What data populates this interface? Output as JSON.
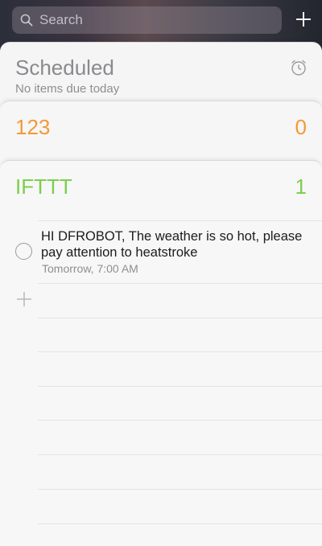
{
  "search": {
    "placeholder": "Search"
  },
  "header": {
    "add_icon": "plus-icon"
  },
  "scheduled": {
    "title": "Scheduled",
    "subtitle": "No items due today",
    "icon": "alarm-clock-icon"
  },
  "lists": [
    {
      "title": "123",
      "count": "0",
      "color": "#f19a38"
    },
    {
      "title": "IFTTT",
      "count": "1",
      "color": "#7ccf4c"
    }
  ],
  "reminders": [
    {
      "text": "HI DFROBOT, The weather is so hot, please pay attention to heatstroke",
      "time": "Tomorrow, 7:00 AM",
      "checked": false
    }
  ],
  "add_item": {
    "icon": "plus-icon"
  }
}
